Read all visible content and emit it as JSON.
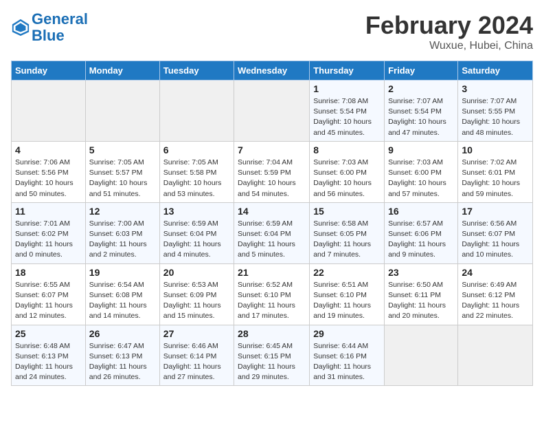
{
  "header": {
    "logo_line1": "General",
    "logo_line2": "Blue",
    "title": "February 2024",
    "location": "Wuxue, Hubei, China"
  },
  "weekdays": [
    "Sunday",
    "Monday",
    "Tuesday",
    "Wednesday",
    "Thursday",
    "Friday",
    "Saturday"
  ],
  "weeks": [
    [
      {
        "day": "",
        "info": ""
      },
      {
        "day": "",
        "info": ""
      },
      {
        "day": "",
        "info": ""
      },
      {
        "day": "",
        "info": ""
      },
      {
        "day": "1",
        "info": "Sunrise: 7:08 AM\nSunset: 5:54 PM\nDaylight: 10 hours and 45 minutes."
      },
      {
        "day": "2",
        "info": "Sunrise: 7:07 AM\nSunset: 5:54 PM\nDaylight: 10 hours and 47 minutes."
      },
      {
        "day": "3",
        "info": "Sunrise: 7:07 AM\nSunset: 5:55 PM\nDaylight: 10 hours and 48 minutes."
      }
    ],
    [
      {
        "day": "4",
        "info": "Sunrise: 7:06 AM\nSunset: 5:56 PM\nDaylight: 10 hours and 50 minutes."
      },
      {
        "day": "5",
        "info": "Sunrise: 7:05 AM\nSunset: 5:57 PM\nDaylight: 10 hours and 51 minutes."
      },
      {
        "day": "6",
        "info": "Sunrise: 7:05 AM\nSunset: 5:58 PM\nDaylight: 10 hours and 53 minutes."
      },
      {
        "day": "7",
        "info": "Sunrise: 7:04 AM\nSunset: 5:59 PM\nDaylight: 10 hours and 54 minutes."
      },
      {
        "day": "8",
        "info": "Sunrise: 7:03 AM\nSunset: 6:00 PM\nDaylight: 10 hours and 56 minutes."
      },
      {
        "day": "9",
        "info": "Sunrise: 7:03 AM\nSunset: 6:00 PM\nDaylight: 10 hours and 57 minutes."
      },
      {
        "day": "10",
        "info": "Sunrise: 7:02 AM\nSunset: 6:01 PM\nDaylight: 10 hours and 59 minutes."
      }
    ],
    [
      {
        "day": "11",
        "info": "Sunrise: 7:01 AM\nSunset: 6:02 PM\nDaylight: 11 hours and 0 minutes."
      },
      {
        "day": "12",
        "info": "Sunrise: 7:00 AM\nSunset: 6:03 PM\nDaylight: 11 hours and 2 minutes."
      },
      {
        "day": "13",
        "info": "Sunrise: 6:59 AM\nSunset: 6:04 PM\nDaylight: 11 hours and 4 minutes."
      },
      {
        "day": "14",
        "info": "Sunrise: 6:59 AM\nSunset: 6:04 PM\nDaylight: 11 hours and 5 minutes."
      },
      {
        "day": "15",
        "info": "Sunrise: 6:58 AM\nSunset: 6:05 PM\nDaylight: 11 hours and 7 minutes."
      },
      {
        "day": "16",
        "info": "Sunrise: 6:57 AM\nSunset: 6:06 PM\nDaylight: 11 hours and 9 minutes."
      },
      {
        "day": "17",
        "info": "Sunrise: 6:56 AM\nSunset: 6:07 PM\nDaylight: 11 hours and 10 minutes."
      }
    ],
    [
      {
        "day": "18",
        "info": "Sunrise: 6:55 AM\nSunset: 6:07 PM\nDaylight: 11 hours and 12 minutes."
      },
      {
        "day": "19",
        "info": "Sunrise: 6:54 AM\nSunset: 6:08 PM\nDaylight: 11 hours and 14 minutes."
      },
      {
        "day": "20",
        "info": "Sunrise: 6:53 AM\nSunset: 6:09 PM\nDaylight: 11 hours and 15 minutes."
      },
      {
        "day": "21",
        "info": "Sunrise: 6:52 AM\nSunset: 6:10 PM\nDaylight: 11 hours and 17 minutes."
      },
      {
        "day": "22",
        "info": "Sunrise: 6:51 AM\nSunset: 6:10 PM\nDaylight: 11 hours and 19 minutes."
      },
      {
        "day": "23",
        "info": "Sunrise: 6:50 AM\nSunset: 6:11 PM\nDaylight: 11 hours and 20 minutes."
      },
      {
        "day": "24",
        "info": "Sunrise: 6:49 AM\nSunset: 6:12 PM\nDaylight: 11 hours and 22 minutes."
      }
    ],
    [
      {
        "day": "25",
        "info": "Sunrise: 6:48 AM\nSunset: 6:13 PM\nDaylight: 11 hours and 24 minutes."
      },
      {
        "day": "26",
        "info": "Sunrise: 6:47 AM\nSunset: 6:13 PM\nDaylight: 11 hours and 26 minutes."
      },
      {
        "day": "27",
        "info": "Sunrise: 6:46 AM\nSunset: 6:14 PM\nDaylight: 11 hours and 27 minutes."
      },
      {
        "day": "28",
        "info": "Sunrise: 6:45 AM\nSunset: 6:15 PM\nDaylight: 11 hours and 29 minutes."
      },
      {
        "day": "29",
        "info": "Sunrise: 6:44 AM\nSunset: 6:16 PM\nDaylight: 11 hours and 31 minutes."
      },
      {
        "day": "",
        "info": ""
      },
      {
        "day": "",
        "info": ""
      }
    ]
  ]
}
